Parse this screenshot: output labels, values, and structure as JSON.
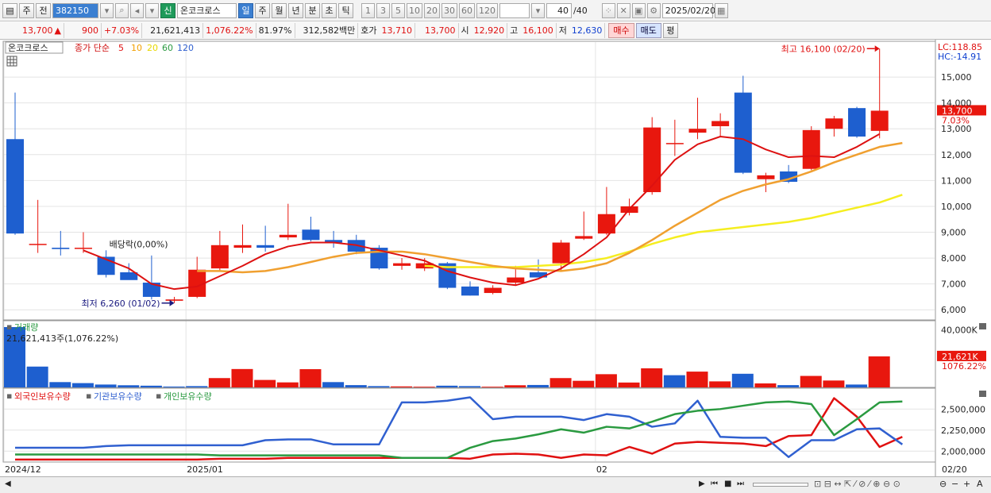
{
  "toolbar": {
    "market_btn": "주",
    "prev_btn": "전",
    "code": "382150",
    "tag_new": "신",
    "stock_name": "온코크로스",
    "periods": [
      "일",
      "주",
      "월",
      "년",
      "분",
      "초",
      "틱"
    ],
    "numbers": [
      "1",
      "3",
      "5",
      "10",
      "20",
      "30",
      "60",
      "120"
    ],
    "count": "40",
    "count_total": "/40",
    "date": "2025/02/20"
  },
  "quote": {
    "price": "13,700",
    "arrow": "▲",
    "change": "900",
    "change_pct": "+7.03%",
    "volume": "21,621,413",
    "volume_pct": "1,076.22%",
    "turnover": "81.97%",
    "amount": "312,582백만",
    "ask_label": "호가",
    "ask1": "13,710",
    "ask2": "13,700",
    "open_label": "시",
    "open": "12,920",
    "high_label": "고",
    "high": "16,100",
    "low_label": "저",
    "low": "12,630",
    "buy_label": "매수",
    "sell_label": "매도",
    "avg_label": "평"
  },
  "legend": {
    "name": "온코크로스",
    "ma_label": "종가 단순",
    "ma_periods": [
      "5",
      "10",
      "20",
      "60",
      "120"
    ],
    "ma_colors": [
      "#e01010",
      "#f2a000",
      "#f0e000",
      "#2a9a40",
      "#3060d0"
    ]
  },
  "right_info": {
    "lc": "LC:118.85",
    "hc": "HC:-14.91"
  },
  "colors": {
    "up": "#e8170e",
    "down": "#1e5fcf",
    "ma5": "#dd1111",
    "ma10": "#f0a030",
    "ma20": "#f5ee20",
    "grid": "#e4e4e4"
  },
  "chart_data": [
    {
      "type": "candlestick",
      "title": "",
      "ylim": [
        5700,
        16200
      ],
      "y_ticks": [
        "6,000",
        "7,000",
        "8,000",
        "9,000",
        "10,000",
        "11,000",
        "12,000",
        "13,000",
        "14,000",
        "15,000"
      ],
      "y_tick_values": [
        6000,
        7000,
        8000,
        9000,
        10000,
        11000,
        12000,
        13000,
        14000,
        15000
      ],
      "x_labels": [
        {
          "label": "2024/12",
          "index": 0
        },
        {
          "label": "2025/01",
          "index": 8
        },
        {
          "label": "02",
          "index": 26
        }
      ],
      "last_date": "02/20",
      "ohlc": [
        [
          12600,
          14400,
          8900,
          8950
        ],
        [
          8550,
          10250,
          8200,
          8550
        ],
        [
          8400,
          9050,
          8100,
          8350
        ],
        [
          8400,
          9000,
          8200,
          8400
        ],
        [
          8050,
          8300,
          7250,
          7350
        ],
        [
          7450,
          7800,
          7200,
          7150
        ],
        [
          7050,
          8100,
          6400,
          6500
        ],
        [
          6350,
          6500,
          6260,
          6400
        ],
        [
          6500,
          8050,
          6450,
          7550
        ],
        [
          7600,
          9050,
          7500,
          8500
        ],
        [
          8400,
          9300,
          8200,
          8500
        ],
        [
          8500,
          9250,
          8250,
          8400
        ],
        [
          8800,
          10100,
          8700,
          8900
        ],
        [
          9100,
          9600,
          8650,
          8700
        ],
        [
          8700,
          9050,
          8400,
          8600
        ],
        [
          8700,
          8900,
          8150,
          8250
        ],
        [
          8400,
          8500,
          7550,
          7600
        ],
        [
          7700,
          8000,
          7550,
          7800
        ],
        [
          7600,
          8000,
          7500,
          7800
        ],
        [
          7800,
          7850,
          6800,
          6850
        ],
        [
          6900,
          7100,
          6550,
          6550
        ],
        [
          6650,
          6950,
          6600,
          6850
        ],
        [
          7050,
          7700,
          6950,
          7250
        ],
        [
          7450,
          7950,
          7350,
          7250
        ],
        [
          7800,
          8700,
          7500,
          8600
        ],
        [
          8750,
          9800,
          8700,
          8850
        ],
        [
          8950,
          10750,
          8900,
          9700
        ],
        [
          9750,
          10300,
          9650,
          10000
        ],
        [
          10550,
          13450,
          10450,
          13050
        ],
        [
          12450,
          13350,
          11950,
          12450
        ],
        [
          12850,
          14200,
          12600,
          13000
        ],
        [
          13100,
          13600,
          12700,
          13300
        ],
        [
          14400,
          15050,
          11250,
          11300
        ],
        [
          11050,
          11300,
          10550,
          11200
        ],
        [
          11350,
          11600,
          10900,
          10950
        ],
        [
          11450,
          13100,
          11400,
          12950
        ],
        [
          13000,
          13500,
          12700,
          13400
        ],
        [
          13800,
          13850,
          12650,
          12700
        ],
        [
          12920,
          16100,
          12630,
          13700
        ]
      ],
      "ma5": [
        null,
        null,
        null,
        null,
        8300,
        7950,
        7600,
        7000,
        6800,
        6900,
        7300,
        7700,
        8150,
        8450,
        8600,
        8600,
        8500,
        8300,
        8100,
        7900,
        7500,
        7250,
        7050,
        6950,
        7200,
        7600,
        8150,
        8800,
        9900,
        10800,
        11800,
        12400,
        12700,
        12600,
        12200,
        11900,
        11950,
        11900,
        12300,
        12800
      ],
      "ma10": [
        null,
        null,
        null,
        null,
        null,
        null,
        null,
        null,
        null,
        7500,
        7500,
        7450,
        7500,
        7650,
        7850,
        8050,
        8200,
        8250,
        8250,
        8150,
        8000,
        7850,
        7700,
        7600,
        7550,
        7500,
        7600,
        7800,
        8200,
        8700,
        9250,
        9750,
        10250,
        10600,
        10850,
        11050,
        11350,
        11700,
        12000,
        12300,
        12450
      ],
      "ma20": [
        null,
        null,
        null,
        null,
        null,
        null,
        null,
        null,
        null,
        null,
        null,
        null,
        null,
        null,
        null,
        null,
        null,
        null,
        null,
        7700,
        7650,
        7650,
        7650,
        7650,
        7700,
        7750,
        7850,
        8000,
        8250,
        8550,
        8800,
        9000,
        9100,
        9200,
        9300,
        9400,
        9550,
        9750,
        9950,
        10150,
        10450
      ],
      "annotations": [
        {
          "text": "최고 16,100 (02/20)",
          "index": 38,
          "value": 16100,
          "side": "left",
          "color": "#e01010"
        },
        {
          "text": "최저 6,260 (01/02)",
          "index": 7,
          "value": 6260,
          "side": "left",
          "color": "#1a1a80"
        },
        {
          "text": "배당락(0,00%)",
          "index": 4,
          "value": 8300,
          "side": "right",
          "color": "#222222"
        }
      ],
      "last_price_label": "13,700",
      "last_change_label": "7.03%"
    },
    {
      "type": "bar",
      "title": "거래량",
      "summary": "21,621,413주(1,076.22%)",
      "y_ticks": [
        "40,000K"
      ],
      "ylim": [
        0,
        42000
      ],
      "values": [
        42000,
        14500,
        3700,
        3000,
        2000,
        1500,
        1200,
        600,
        900,
        6500,
        12800,
        5200,
        3500,
        12700,
        3700,
        1600,
        900,
        700,
        500,
        1200,
        900,
        500,
        1500,
        1700,
        6500,
        4600,
        9200,
        3400,
        13300,
        8500,
        11000,
        4200,
        9500,
        2800,
        1600,
        8000,
        4800,
        2000,
        21621
      ],
      "up": [
        false,
        false,
        false,
        false,
        false,
        false,
        false,
        false,
        false,
        true,
        true,
        true,
        true,
        true,
        false,
        false,
        false,
        true,
        true,
        false,
        false,
        true,
        true,
        false,
        true,
        true,
        true,
        true,
        true,
        false,
        true,
        true,
        false,
        true,
        false,
        true,
        true,
        false,
        true
      ],
      "last_label": "21,621K",
      "last_pct_label": "1076.22%"
    },
    {
      "type": "line",
      "series": [
        {
          "name": "외국인보유수량",
          "color": "#e01010",
          "values": [
            1900000,
            1900000,
            1900000,
            1900000,
            1900000,
            1900000,
            1900000,
            1900000,
            1900000,
            1910000,
            1910000,
            1910000,
            1920000,
            1920000,
            1920000,
            1920000,
            1920000,
            1920000,
            1920000,
            1920000,
            1910000,
            1960000,
            1970000,
            1960000,
            1920000,
            1960000,
            1950000,
            2050000,
            1970000,
            2090000,
            2110000,
            2100000,
            2090000,
            2060000,
            2180000,
            2190000,
            2630000,
            2410000,
            2050000,
            2170000
          ]
        },
        {
          "name": "기관보유수량",
          "color": "#3060d0",
          "values": [
            2040000,
            2040000,
            2040000,
            2040000,
            2060000,
            2070000,
            2070000,
            2070000,
            2070000,
            2070000,
            2070000,
            2130000,
            2140000,
            2140000,
            2080000,
            2080000,
            2080000,
            2580000,
            2580000,
            2600000,
            2640000,
            2380000,
            2410000,
            2410000,
            2410000,
            2370000,
            2440000,
            2410000,
            2290000,
            2330000,
            2600000,
            2170000,
            2160000,
            2160000,
            1930000,
            2130000,
            2130000,
            2260000,
            2270000,
            2080000
          ]
        },
        {
          "name": "개인보유수량",
          "color": "#2a9a40",
          "values": [
            1960000,
            1960000,
            1960000,
            1960000,
            1960000,
            1960000,
            1960000,
            1960000,
            1960000,
            1950000,
            1950000,
            1950000,
            1950000,
            1950000,
            1950000,
            1950000,
            1950000,
            1920000,
            1920000,
            1920000,
            2040000,
            2120000,
            2150000,
            2200000,
            2260000,
            2220000,
            2290000,
            2270000,
            2350000,
            2440000,
            2480000,
            2500000,
            2540000,
            2580000,
            2590000,
            2560000,
            2190000,
            2380000,
            2580000,
            2590000
          ]
        }
      ],
      "ylim": [
        1880000,
        2720000
      ],
      "y_ticks": [
        "2,000,000",
        "2,250,000",
        "2,500,000"
      ],
      "y_tick_values": [
        2000000,
        2250000,
        2500000
      ]
    }
  ]
}
